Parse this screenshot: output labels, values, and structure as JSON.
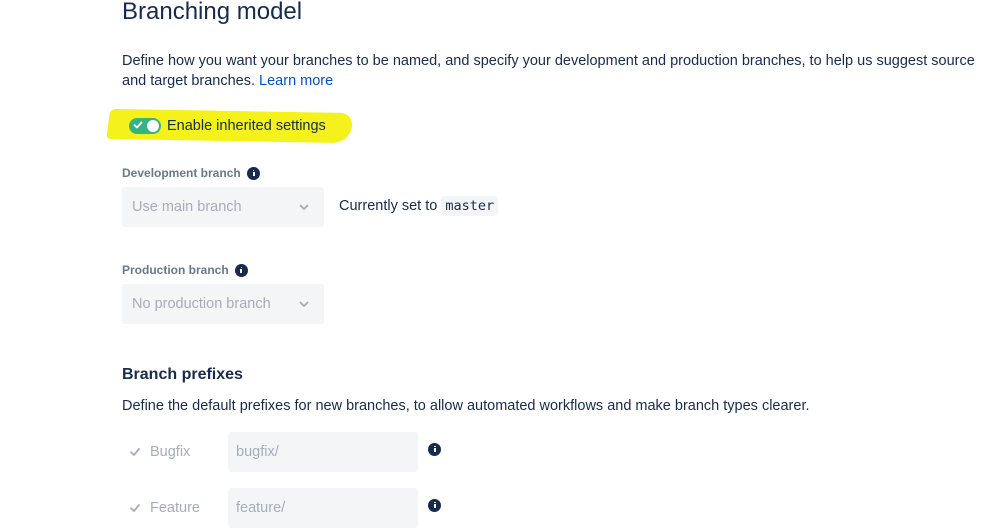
{
  "header": {
    "title": "Branching model",
    "description": "Define how you want your branches to be named, and specify your development and production branches, to help us suggest source and target branches.",
    "learn_more": "Learn more"
  },
  "inherit": {
    "label": "Enable inherited settings",
    "enabled": true,
    "highlight_color": "#f4f21a",
    "toggle_color": "#36b37e"
  },
  "development": {
    "label": "Development branch",
    "selected": "Use main branch",
    "current_prefix": "Currently set to",
    "current_value": "master"
  },
  "production": {
    "label": "Production branch",
    "selected": "No production branch"
  },
  "prefixes": {
    "title": "Branch prefixes",
    "description": "Define the default prefixes for new branches, to allow automated workflows and make branch types clearer.",
    "items": [
      {
        "name": "Bugfix",
        "value": "bugfix/",
        "checked": true
      },
      {
        "name": "Feature",
        "value": "feature/",
        "checked": true
      }
    ]
  },
  "icons": {
    "info": "info-icon",
    "chevron": "chevron-down-icon",
    "check": "check-icon"
  },
  "colors": {
    "text": "#172b4d",
    "link": "#0052cc",
    "muted": "#a5adba",
    "field_bg": "#f4f5f7"
  }
}
